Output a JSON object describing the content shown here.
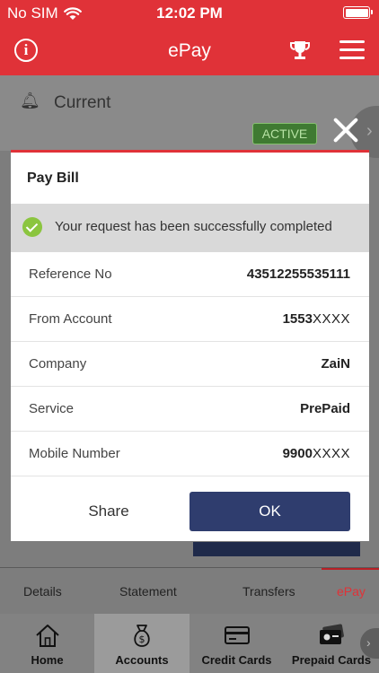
{
  "status_bar": {
    "carrier": "No SIM",
    "time": "12:02 PM"
  },
  "header": {
    "title": "ePay"
  },
  "background": {
    "section_title": "Current",
    "status_badge": "ACTIVE"
  },
  "dialog": {
    "title": "Pay Bill",
    "success_message": "Your request has been successfully completed",
    "rows": [
      {
        "label": "Reference No",
        "value": "43512255535111",
        "masked": ""
      },
      {
        "label": "From Account",
        "value": "1553",
        "masked": "XXXX"
      },
      {
        "label": "Company",
        "value": "ZaiN",
        "masked": ""
      },
      {
        "label": "Service",
        "value": "PrePaid",
        "masked": ""
      },
      {
        "label": "Mobile Number",
        "value": "9900",
        "masked": "XXXX"
      }
    ],
    "share_label": "Share",
    "ok_label": "OK"
  },
  "tabs": [
    {
      "label": "Details"
    },
    {
      "label": "Statement"
    },
    {
      "label": "Transfers"
    },
    {
      "label": "ePay"
    }
  ],
  "bottom_nav": [
    {
      "label": "Home",
      "icon": "home-icon"
    },
    {
      "label": "Accounts",
      "icon": "accounts-icon"
    },
    {
      "label": "Credit Cards",
      "icon": "credit-card-icon"
    },
    {
      "label": "Prepaid Cards",
      "icon": "prepaid-card-icon"
    }
  ],
  "colors": {
    "brand_red": "#e03238",
    "ok_button": "#2f3d6e",
    "success_green": "#8bc53f",
    "active_badge": "#3f7a32"
  }
}
